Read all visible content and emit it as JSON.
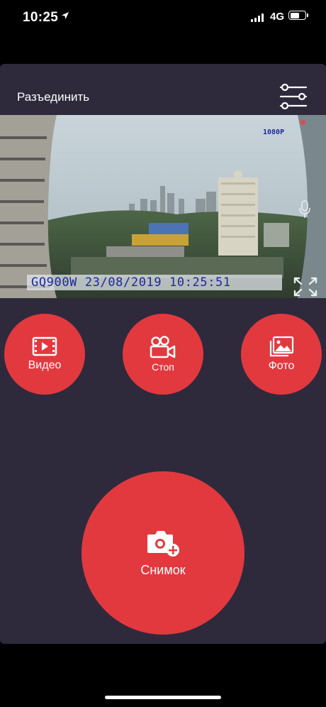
{
  "status_bar": {
    "time": "10:25",
    "network": "4G",
    "battery_level": 0.65
  },
  "header": {
    "disconnect_label": "Разъединить"
  },
  "camera": {
    "resolution_label": "1080P",
    "osd_text": "GQ900W 23/08/2019 10:25:51"
  },
  "buttons": {
    "video": "Видео",
    "stop": "Стоп",
    "photo": "Фото",
    "snapshot": "Снимок"
  },
  "colors": {
    "accent": "#e2393f",
    "panel_bg": "#2e2a3c"
  },
  "icons": [
    "location-arrow-icon",
    "signal-icon",
    "battery-icon",
    "settings-sliders-icon",
    "expand-icon",
    "mic-icon",
    "video-film-icon",
    "video-camera-icon",
    "photo-gallery-icon",
    "camera-plus-icon"
  ]
}
